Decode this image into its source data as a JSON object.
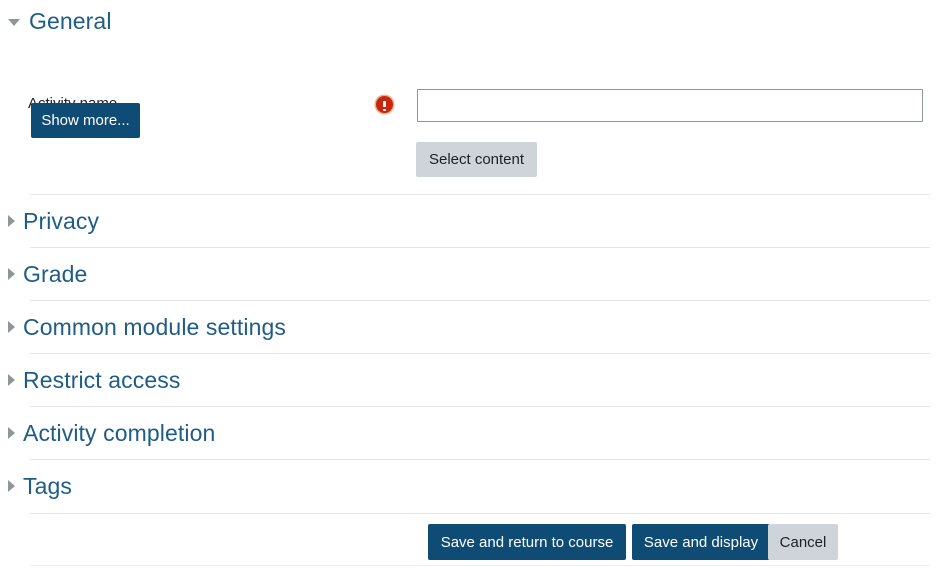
{
  "colors": {
    "heading": "#1f5c86",
    "primary_button_bg": "#0f4c75",
    "primary_button_text": "#ffffff",
    "secondary_button_bg": "#ced4da",
    "secondary_button_text": "#1d2125",
    "required_icon": "#c9260f",
    "divider": "#e3e5e7",
    "input_border": "#8e979e",
    "page_background": "#ffffff",
    "triangle": "#8d9699"
  },
  "general_section": {
    "legend": "General",
    "expanded": true,
    "toggle_icon": "chevron-down-icon",
    "fields": [
      {
        "label": "Activity name",
        "required": true,
        "required_icon": "required-exclamation-icon",
        "value": "",
        "placeholder": ""
      }
    ],
    "show_more_label": "Show more...",
    "select_content_label": "Select content"
  },
  "collapsed_sections": [
    {
      "label": "Privacy",
      "expanded": false,
      "toggle_icon": "chevron-right-icon"
    },
    {
      "label": "Grade",
      "expanded": false,
      "toggle_icon": "chevron-right-icon"
    },
    {
      "label": "Common module settings",
      "expanded": false,
      "toggle_icon": "chevron-right-icon"
    },
    {
      "label": "Restrict access",
      "expanded": false,
      "toggle_icon": "chevron-right-icon"
    },
    {
      "label": "Activity completion",
      "expanded": false,
      "toggle_icon": "chevron-right-icon"
    },
    {
      "label": "Tags",
      "expanded": false,
      "toggle_icon": "chevron-right-icon"
    }
  ],
  "footer": {
    "save_and_return_label": "Save and return to course",
    "save_and_display_label": "Save and display",
    "cancel_label": "Cancel"
  }
}
